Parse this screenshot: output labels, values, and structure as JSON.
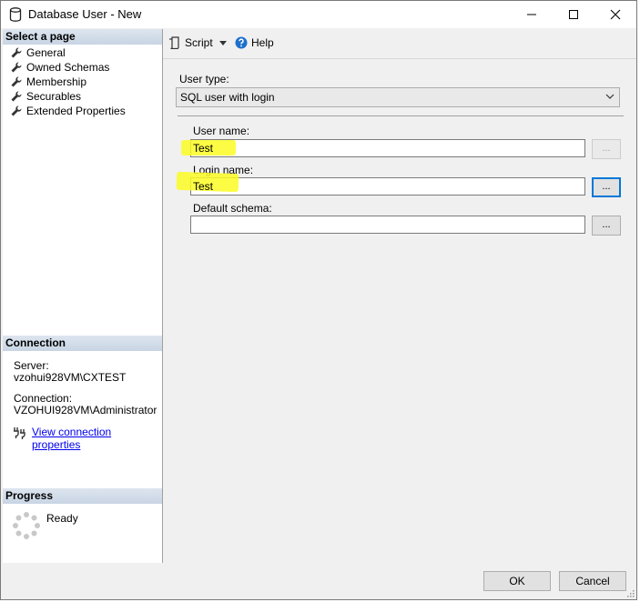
{
  "window": {
    "title": "Database User - New"
  },
  "left": {
    "select_page_header": "Select a page",
    "pages": [
      {
        "label": "General"
      },
      {
        "label": "Owned Schemas"
      },
      {
        "label": "Membership"
      },
      {
        "label": "Securables"
      },
      {
        "label": "Extended Properties"
      }
    ],
    "connection_header": "Connection",
    "server_label": "Server:",
    "server_value": "vzohui928VM\\CXTEST",
    "connection_label": "Connection:",
    "connection_value": "VZOHUI928VM\\Administrator",
    "view_connection_link": "View connection properties",
    "progress_header": "Progress",
    "progress_status": "Ready"
  },
  "toolbar": {
    "script_label": "Script",
    "help_label": "Help"
  },
  "form": {
    "user_type_label": "User type:",
    "user_type_value": "SQL user with login",
    "user_name_label": "User name:",
    "user_name_value": "Test",
    "login_name_label": "Login name:",
    "login_name_value": "Test",
    "default_schema_label": "Default schema:",
    "default_schema_value": "",
    "browse_label": "..."
  },
  "buttons": {
    "ok_label": "OK",
    "cancel_label": "Cancel"
  },
  "colors": {
    "highlight": "#fbfb23",
    "link": "#0000ee",
    "section_header": "#d3dcea"
  },
  "icons": [
    "database-icon",
    "wrench-icon",
    "script-icon",
    "help-icon",
    "plug-icon",
    "spinner-icon",
    "chevron-down-icon"
  ]
}
